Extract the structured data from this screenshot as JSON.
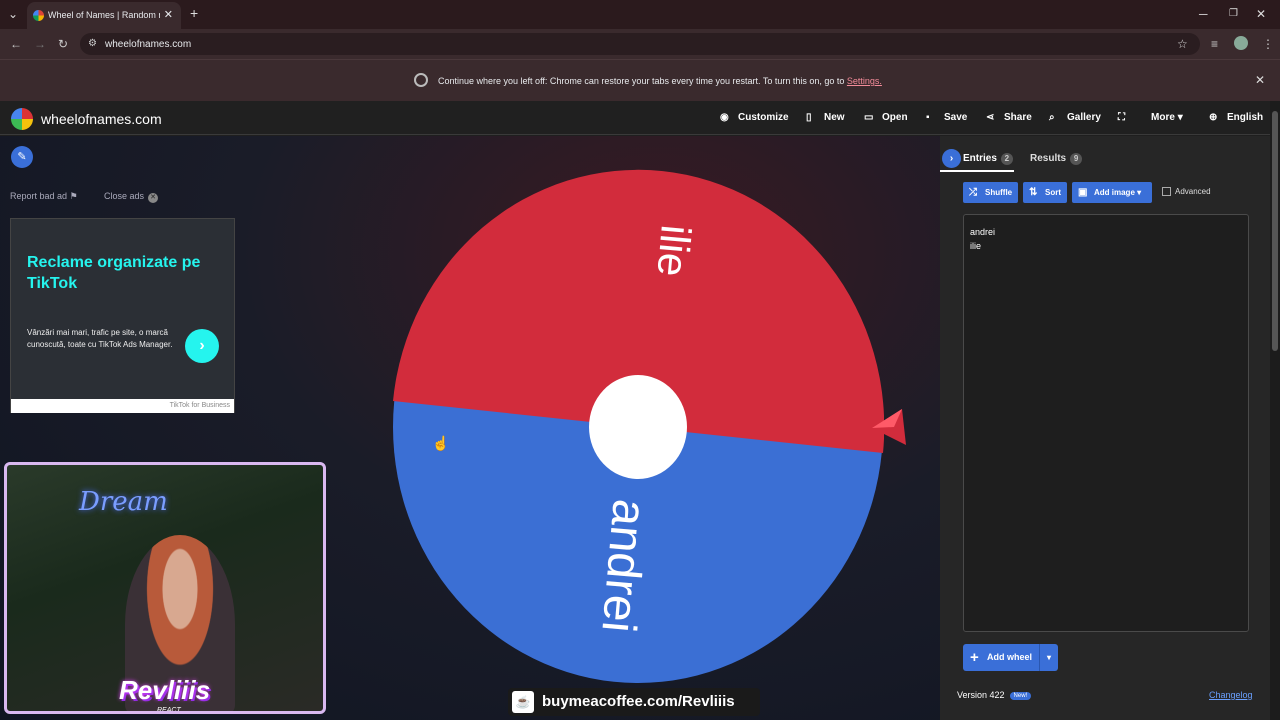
{
  "browser": {
    "tab_title": "Wheel of Names | Random nam",
    "url": "wheelofnames.com",
    "restore_message": "Continue where you left off: Chrome can restore your tabs every time you restart. To turn this on, go to",
    "restore_link": "Settings."
  },
  "site": {
    "name": "wheelofnames.com",
    "nav": [
      {
        "label": "Customize",
        "icon": "palette-icon"
      },
      {
        "label": "New",
        "icon": "file-icon"
      },
      {
        "label": "Open",
        "icon": "folder-icon"
      },
      {
        "label": "Save",
        "icon": "save-icon"
      },
      {
        "label": "Share",
        "icon": "share-icon"
      },
      {
        "label": "Gallery",
        "icon": "search-icon"
      },
      {
        "label": "More",
        "icon": "fullscreen-icon"
      },
      {
        "label": "English",
        "icon": "globe-icon"
      }
    ]
  },
  "ads": {
    "report_label": "Report bad ad",
    "close_label": "Close ads",
    "headline": "Reclame organizate pe TikTok",
    "body": "Vânzări mai mari, trafic pe site, o marcă cunoscută, toate cu TikTok Ads Manager.",
    "footer": "TikTok for Business"
  },
  "wheel": {
    "segments": [
      {
        "label": "ilie",
        "color": "#d22c3c"
      },
      {
        "label": "andrei",
        "color": "#3b6fd4"
      }
    ]
  },
  "stream": {
    "neon_text": "Dream",
    "streamer_tag": "Revliiis",
    "streamer_sub": "REACT",
    "coffee_text": "buymeacoffee.com/Revliiis"
  },
  "panel": {
    "tab_entries": "Entries",
    "entries_count": "2",
    "tab_results": "Results",
    "results_count": "9",
    "shuffle": "Shuffle",
    "sort": "Sort",
    "add_image": "Add image",
    "advanced": "Advanced",
    "entries": [
      "andrei",
      "ilie"
    ],
    "add_wheel": "Add wheel",
    "version": "Version 422",
    "new_badge": "New!",
    "changelog": "Changelog"
  },
  "colors": {
    "accent": "#3a6fd8",
    "wheel_red": "#d22c3c",
    "wheel_blue": "#3b6fd4"
  }
}
